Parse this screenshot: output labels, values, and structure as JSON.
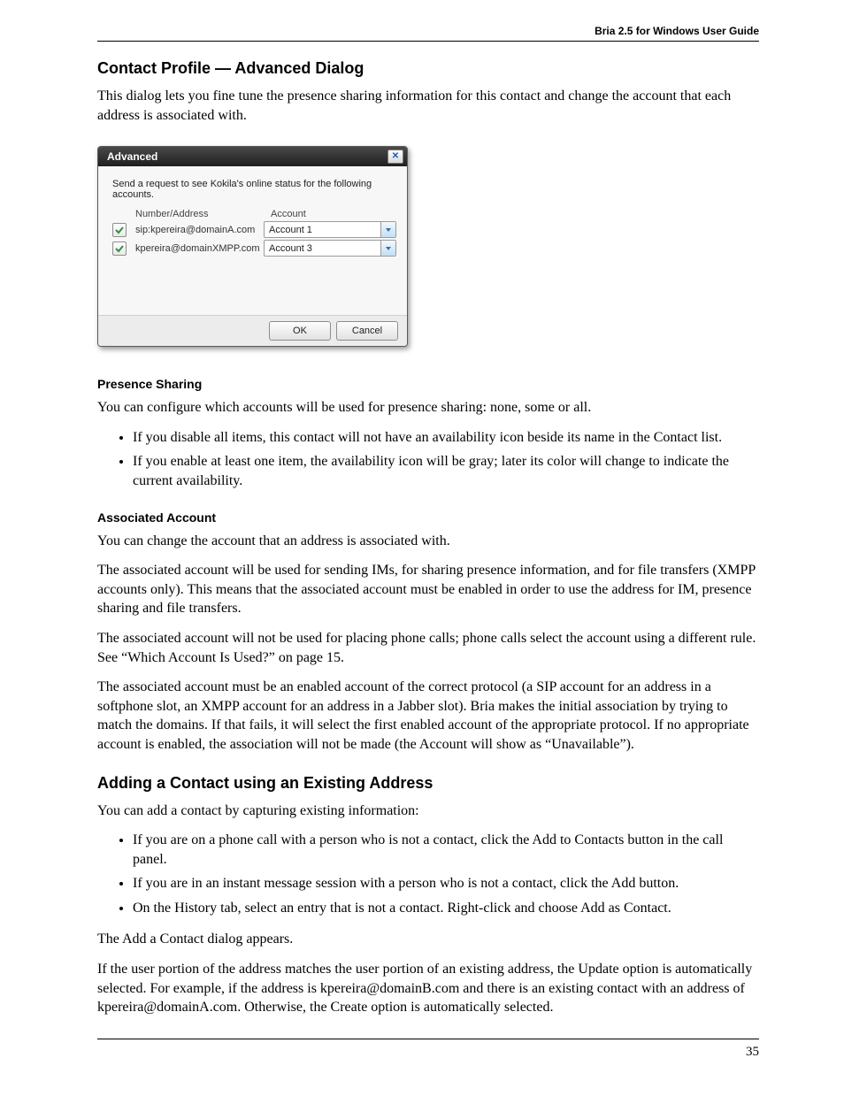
{
  "header": {
    "guide_title": "Bria 2.5 for Windows User Guide"
  },
  "sections": {
    "contact_profile_heading": "Contact Profile — Advanced Dialog",
    "contact_profile_intro": "This dialog lets you fine tune the presence sharing information for this contact and change the account that each address is associated with.",
    "presence_heading": "Presence Sharing",
    "presence_p1": "You can configure which accounts will be used for presence sharing: none, some or all.",
    "presence_li1": "If you disable all items, this contact will not have an availability icon beside its name in the Contact list.",
    "presence_li2": "If you enable at least one item, the availability icon will be gray; later its color will change to indicate the current availability.",
    "assoc_heading": "Associated Account",
    "assoc_p1": "You can change the account that an address is associated with.",
    "assoc_p2": "The associated account will be used for sending IMs, for sharing presence information, and for file transfers (XMPP accounts only). This means that the associated account must be enabled in order to use the address for IM, presence sharing and file transfers.",
    "assoc_p3": "The associated account will not be used for placing phone calls; phone calls select the account using a different rule. See “Which Account Is Used?” on page 15.",
    "assoc_p4": "The associated account must be an enabled account of the correct protocol (a SIP account for an address in a softphone slot, an XMPP account for an address in a Jabber slot). Bria makes the initial association by trying to match the domains. If that fails, it will select the first enabled account of the appropriate protocol. If no appropriate account is enabled, the association will not be made (the Account will show as “Unavailable”).",
    "adding_heading": "Adding a Contact using an Existing Address",
    "adding_p1": "You can add a contact by capturing existing information:",
    "adding_li1": "If you are on a phone call with a person who is not a contact, click the Add to Contacts button in the call panel.",
    "adding_li2": "If you are in an instant message session with a person who is not a contact, click the Add button.",
    "adding_li3": "On the History tab, select an entry that is not a contact. Right-click and choose Add as Contact.",
    "adding_p2": "The Add a Contact dialog appears.",
    "adding_p3": "If the user portion of the address matches the user portion of an existing address, the Update option is automatically selected. For example, if the address is kpereira@domainB.com and there is an existing contact with an address of kpereira@domainA.com. Otherwise, the Create option is automatically selected."
  },
  "dialog": {
    "title": "Advanced",
    "instruction": "Send a request to see Kokila's online status for the following accounts.",
    "col_address": "Number/Address",
    "col_account": "Account",
    "rows": [
      {
        "address": "sip:kpereira@domainA.com",
        "account": "Account 1"
      },
      {
        "address": "kpereira@domainXMPP.com",
        "account": "Account 3"
      }
    ],
    "ok": "OK",
    "cancel": "Cancel"
  },
  "footer": {
    "page_number": "35"
  }
}
